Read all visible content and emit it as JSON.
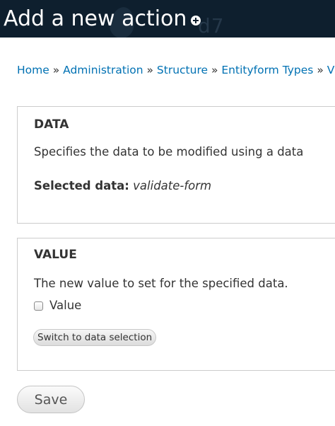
{
  "header": {
    "title": "Add a new action",
    "shortcut_icon": "plus-circle-icon"
  },
  "breadcrumb": {
    "items": [
      "Home",
      "Administration",
      "Structure",
      "Entityform Types",
      "V"
    ],
    "separator": "»"
  },
  "data_fieldset": {
    "legend": "DATA",
    "description": "Specifies the data to be modified using a data",
    "selected_label": "Selected data:",
    "selected_value": "validate-form"
  },
  "value_fieldset": {
    "legend": "VALUE",
    "description": "The new value to set for the specified data.",
    "checkbox_label": "Value",
    "checkbox_checked": false,
    "switch_button_label": "Switch to data selection"
  },
  "actions": {
    "save_label": "Save"
  },
  "colors": {
    "header_background": "#0e1f2e",
    "link": "#0071b3",
    "text": "#333333"
  }
}
